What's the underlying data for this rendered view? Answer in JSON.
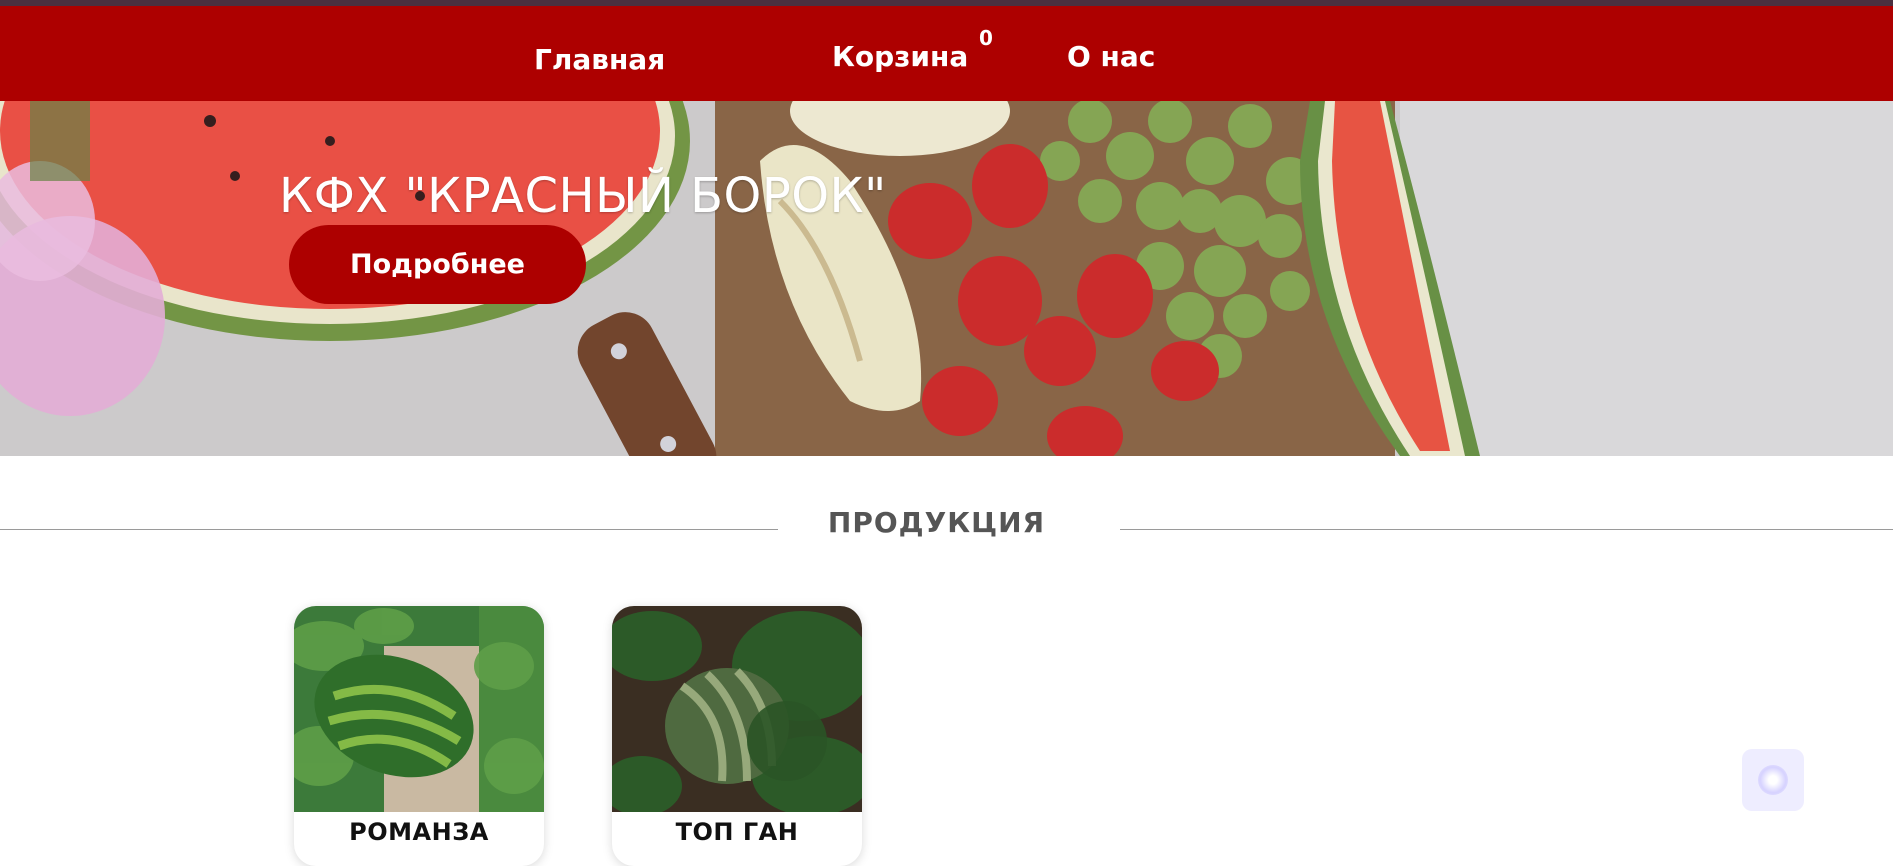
{
  "nav": {
    "home_label": "Главная",
    "cart_label": "Корзина",
    "cart_count": "0",
    "about_label": "О нас"
  },
  "hero": {
    "title": "КФХ \"КРАСНЫЙ БОРОК\"",
    "button_label": "Подробнее"
  },
  "products": {
    "section_title": "ПРОДУКЦИЯ",
    "items": [
      {
        "name": "РОМАНЗА"
      },
      {
        "name": "ТОП ГАН"
      }
    ]
  },
  "colors": {
    "brand_red": "#ad0000",
    "top_strip": "#4a3040",
    "section_text": "#555555"
  }
}
